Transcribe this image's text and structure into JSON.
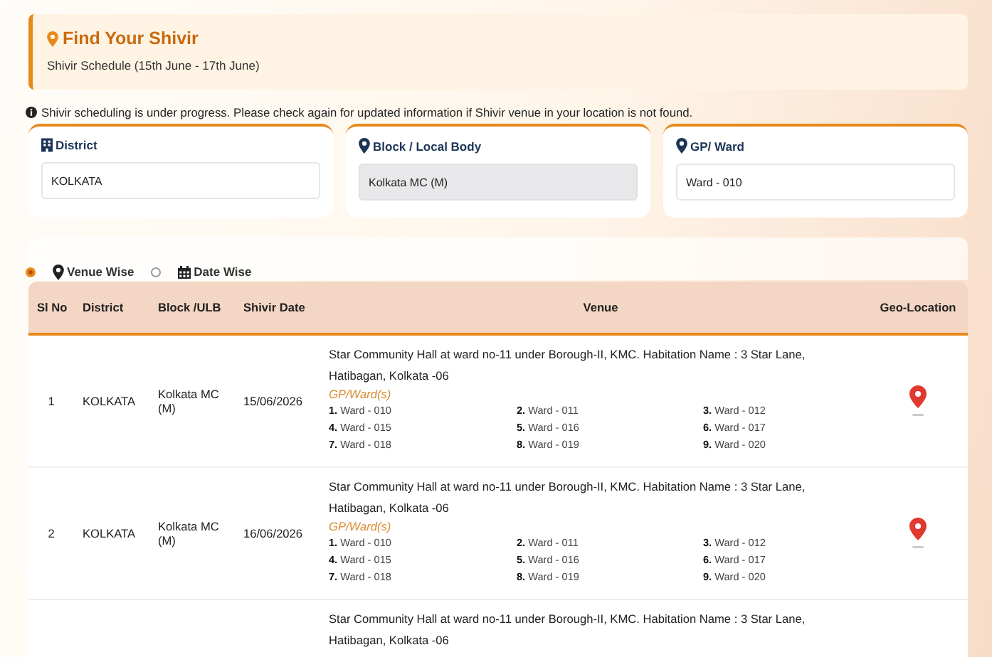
{
  "header": {
    "title": "Find Your Shivir",
    "subtitle": "Shivir Schedule (15th June - 17th June)"
  },
  "notice": "Shivir scheduling is under progress. Please check again for updated information if Shivir venue in your location is not found.",
  "filters": [
    {
      "label": "District",
      "kind": "building",
      "value": "KOLKATA",
      "disabled": false
    },
    {
      "label": "Block / Local Body",
      "kind": "pin",
      "value": "Kolkata MC (M)",
      "disabled": true
    },
    {
      "label": "GP/ Ward",
      "kind": "pin",
      "value": "Ward - 010",
      "disabled": false
    }
  ],
  "view_options": [
    {
      "label": "Venue Wise",
      "kind": "pin",
      "selected": true
    },
    {
      "label": "Date Wise",
      "kind": "calendar",
      "selected": false
    }
  ],
  "table": {
    "columns": [
      "Sl No",
      "District",
      "Block /ULB",
      "Shivir Date",
      "Venue",
      "Geo-Location"
    ],
    "rows": [
      {
        "sl_no": "1",
        "district": "KOLKATA",
        "block": "Kolkata MC (M)",
        "date": "15/06/2026",
        "venue": "Star Community Hall at ward no-11 under Borough-II, KMC. Habitation Name : 3 Star Lane, Hatibagan, Kolkata -06",
        "wards_label": "GP/Ward(s)",
        "wards": [
          "**1.** Ward - 010",
          "**2.** Ward - 011",
          "**3.** Ward - 012",
          "**4.** Ward - 015",
          "**5.** Ward - 016",
          "**6.** Ward - 017",
          "**7.** Ward - 018",
          "**8.** Ward - 019",
          "**9.** Ward - 020"
        ]
      },
      {
        "sl_no": "2",
        "district": "KOLKATA",
        "block": "Kolkata MC (M)",
        "date": "16/06/2026",
        "venue": "Star Community Hall at ward no-11 under Borough-II, KMC. Habitation Name : 3 Star Lane, Hatibagan, Kolkata -06",
        "wards_label": "GP/Ward(s)",
        "wards": [
          "**1.** Ward - 010",
          "**2.** Ward - 011",
          "**3.** Ward - 012",
          "**4.** Ward - 015",
          "**5.** Ward - 016",
          "**6.** Ward - 017",
          "**7.** Ward - 018",
          "**8.** Ward - 019",
          "**9.** Ward - 020"
        ]
      },
      {
        "venue": "Star Community Hall at ward no-11 under Borough-II, KMC. Habitation Name : 3 Star Lane, Hatibagan, Kolkata -06"
      }
    ]
  }
}
